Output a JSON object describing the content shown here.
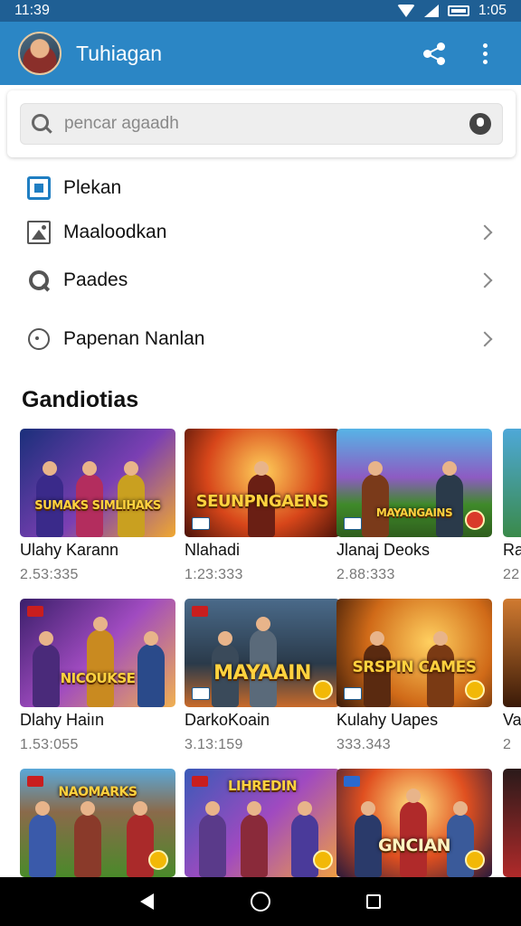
{
  "status": {
    "time_left": "11:39",
    "time_right": "1:05"
  },
  "app_bar": {
    "title": "Tuhiagan",
    "avatar_icon": "warrior-avatar",
    "share_icon": "share-icon",
    "more_icon": "more-vert-icon",
    "color": "#2b86c5"
  },
  "search": {
    "placeholder": "pencar agaadh"
  },
  "menu": [
    {
      "label": "Plekan",
      "icon": "square-icon",
      "chevron": false
    },
    {
      "label": "Maaloodkan",
      "icon": "image-icon",
      "chevron": true
    },
    {
      "label": "Paades",
      "icon": "places-icon",
      "chevron": true
    },
    {
      "label": "Papenan Nanlan",
      "icon": "chat-icon",
      "chevron": true
    }
  ],
  "section": {
    "title": "Gandiotias"
  },
  "games": [
    {
      "thumb_text": "SUMAKS SIMLIHAKS",
      "name": "Ulahy Karann",
      "meta": "2.53:335"
    },
    {
      "thumb_text": "SEUNPNGAENS",
      "name": "Nlahadi",
      "meta": "1:23:333"
    },
    {
      "thumb_text": "MAYANGAINS",
      "name": "Jlanaj Deoks",
      "meta": "2.88:333"
    },
    {
      "thumb_text": "",
      "name": "Ra",
      "meta": "22"
    },
    {
      "thumb_text": "NICOUKSE",
      "name": "Dlahy Haiın",
      "meta": "1.53:055"
    },
    {
      "thumb_text": "MAYAAIN",
      "name": "DarkoKoain",
      "meta": "3.13:159"
    },
    {
      "thumb_text": "SRSPIN CAMES",
      "name": "Kulahy Uapes",
      "meta": "333.343"
    },
    {
      "thumb_text": "",
      "name": "Va",
      "meta": "2"
    },
    {
      "thumb_text": "NAOMARKS",
      "name": "",
      "meta": ""
    },
    {
      "thumb_text": "LIHREDIN",
      "name": "",
      "meta": ""
    },
    {
      "thumb_text": "GNCIAN",
      "name": "",
      "meta": ""
    },
    {
      "thumb_text": "",
      "name": "",
      "meta": ""
    }
  ],
  "nav": {
    "back": "back-icon",
    "home": "home-icon",
    "recents": "recents-icon"
  }
}
